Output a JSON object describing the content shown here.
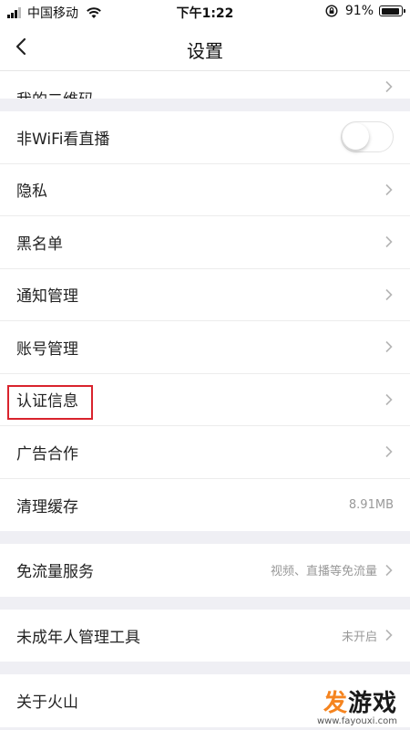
{
  "status_bar": {
    "carrier": "中国移动",
    "time": "下午1:22",
    "battery_percent": "91%",
    "battery_level": 0.91
  },
  "nav": {
    "title": "设置"
  },
  "groups": [
    {
      "rows": [
        {
          "label": "我的二维码",
          "partial": true
        }
      ]
    },
    {
      "rows": [
        {
          "label": "非WiFi看直播",
          "control": "toggle",
          "toggle_on": false
        },
        {
          "label": "隐私"
        },
        {
          "label": "黑名单"
        },
        {
          "label": "通知管理"
        },
        {
          "label": "账号管理"
        },
        {
          "label": "认证信息",
          "highlighted": true
        },
        {
          "label": "广告合作"
        },
        {
          "label": "清理缓存",
          "value": "8.91MB"
        }
      ]
    },
    {
      "rows": [
        {
          "label": "免流量服务",
          "value": "视频、直播等免流量"
        }
      ]
    },
    {
      "rows": [
        {
          "label": "未成年人管理工具",
          "value": "未开启"
        }
      ]
    },
    {
      "rows": [
        {
          "label": "关于火山"
        }
      ]
    }
  ],
  "watermark": {
    "logo_part1": "发",
    "logo_part2": "游戏",
    "url": "www.fayouxi.com"
  },
  "colors": {
    "highlight_border": "#d9232d",
    "background": "#efeff4",
    "watermark_accent": "#f5841f"
  }
}
